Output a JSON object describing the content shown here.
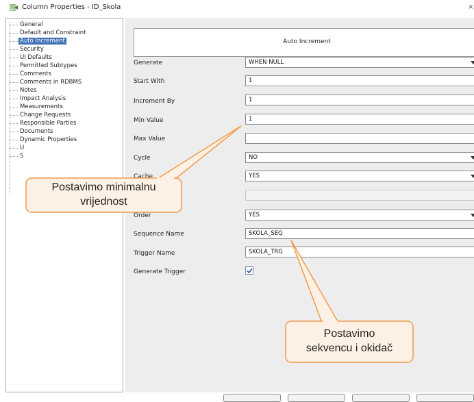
{
  "window": {
    "title": "Column Properties - ID_Skola",
    "close_glyph": "×",
    "icon": "column-properties-icon"
  },
  "tree": {
    "items": [
      {
        "label": "General",
        "selected": false
      },
      {
        "label": "Default and Constraint",
        "selected": false
      },
      {
        "label": "Auto Increment",
        "selected": true
      },
      {
        "label": "Security",
        "selected": false
      },
      {
        "label": "UI Defaults",
        "selected": false
      },
      {
        "label": "Permitted Subtypes",
        "selected": false
      },
      {
        "label": "Comments",
        "selected": false
      },
      {
        "label": "Comments in RDBMS",
        "selected": false
      },
      {
        "label": "Notes",
        "selected": false
      },
      {
        "label": "Impact Analysis",
        "selected": false
      },
      {
        "label": "Measurements",
        "selected": false
      },
      {
        "label": "Change Requests",
        "selected": false
      },
      {
        "label": "Responsible Parties",
        "selected": false
      },
      {
        "label": "Documents",
        "selected": false
      },
      {
        "label": "Dynamic Properties",
        "selected": false
      },
      {
        "label": "U",
        "selected": false
      },
      {
        "label": "S",
        "selected": false
      }
    ]
  },
  "panel": {
    "section_title": "Auto Increment",
    "fields": {
      "generate": {
        "label": "Generate",
        "value": "WHEN NULL"
      },
      "start_with": {
        "label": "Start With",
        "value": "1"
      },
      "increment_by": {
        "label": "Increment By",
        "value": "1"
      },
      "min_value": {
        "label": "Min Value",
        "value": "1"
      },
      "max_value": {
        "label": "Max Value",
        "value": ""
      },
      "cycle": {
        "label": "Cycle",
        "value": "NO"
      },
      "cache": {
        "label": "Cache",
        "value": "YES"
      },
      "cache_size": {
        "label": "",
        "value": ""
      },
      "order": {
        "label": "Order",
        "value": "YES"
      },
      "sequence_name": {
        "label": "Sequence Name",
        "value": "SKOLA_SEQ"
      },
      "trigger_name": {
        "label": "Trigger Name",
        "value": "SKOLA_TRG"
      },
      "generate_trigger": {
        "label": "Generate Trigger",
        "checked": true
      }
    }
  },
  "callouts": {
    "min_value_note": "Postavimo minimalnu vrijednost",
    "min_value_note_line1": "Postavimo minimalnu",
    "min_value_note_line2": "vrijednost",
    "sequence_note_line1": "Postavimo",
    "sequence_note_line2": "sekvencu i okidač",
    "color_border": "#f29a4a",
    "color_fill": "#fdf0e4"
  }
}
